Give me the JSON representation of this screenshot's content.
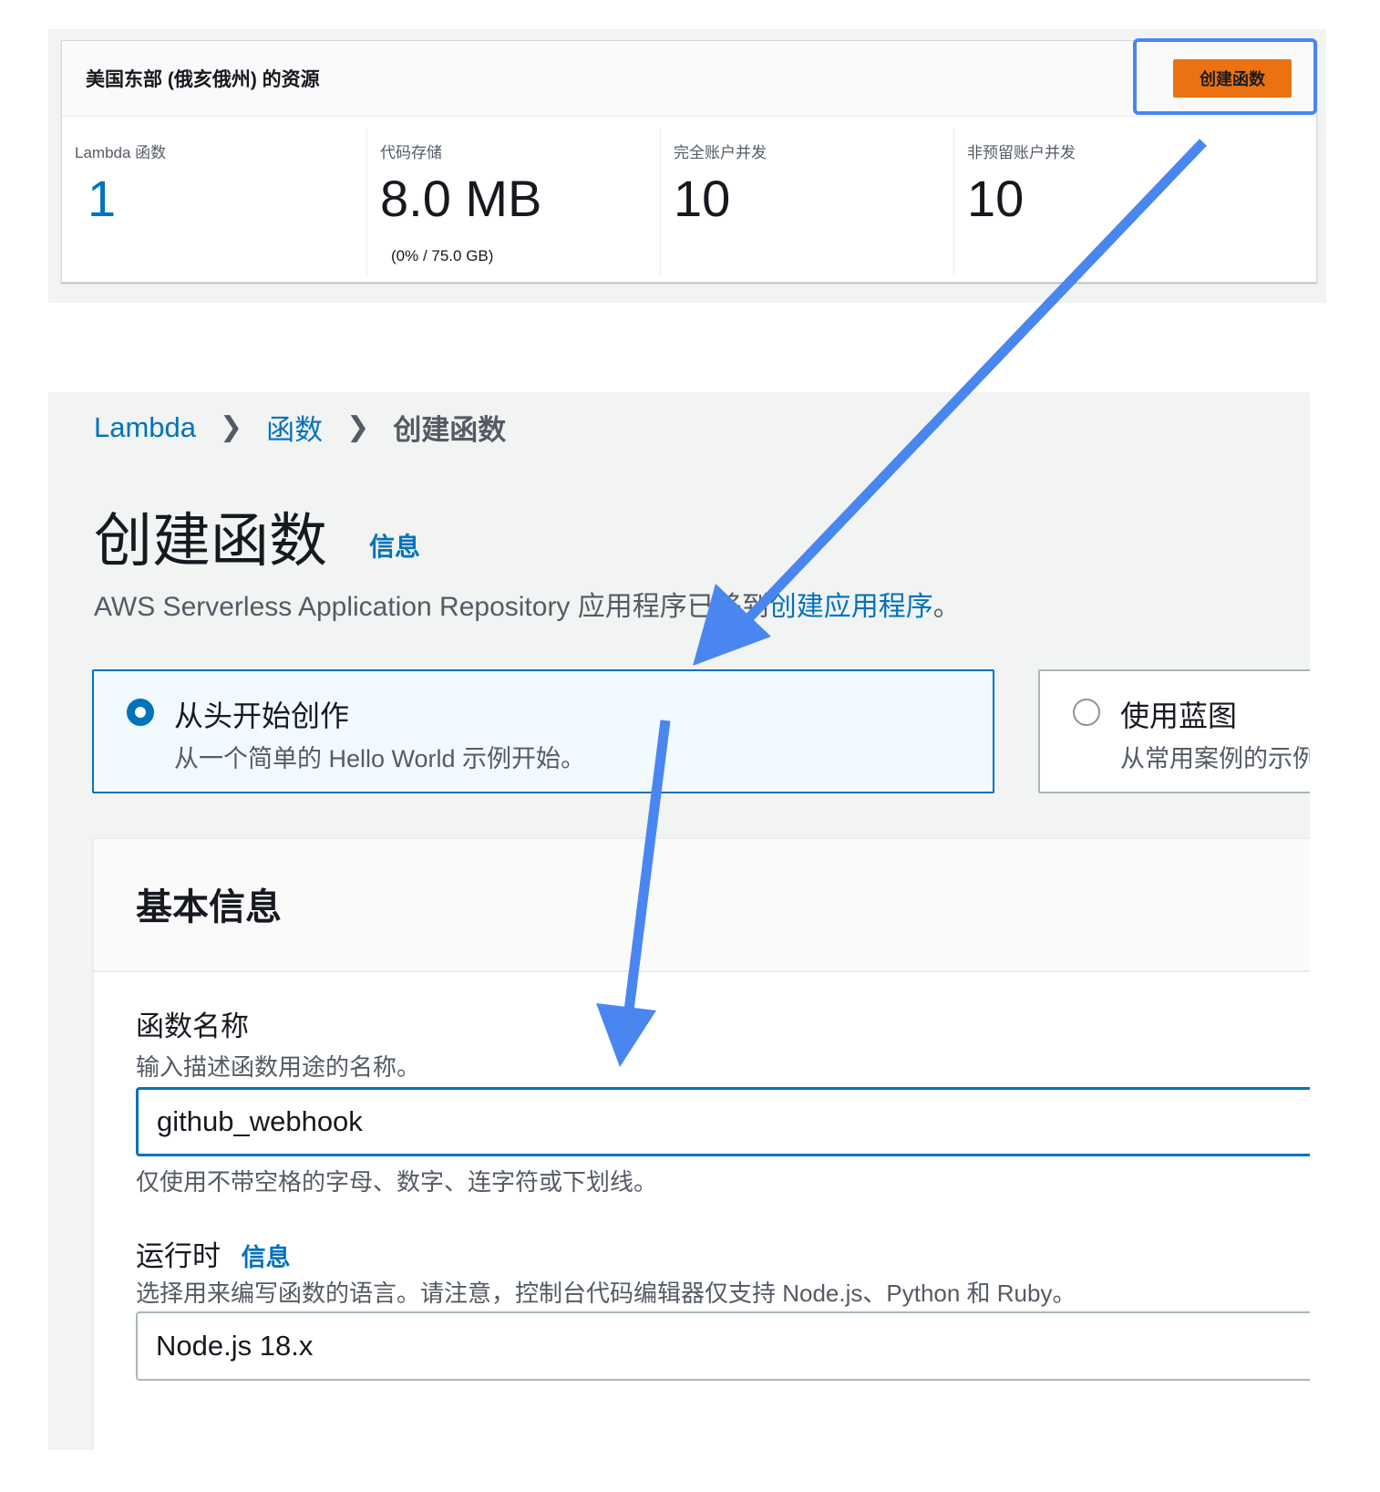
{
  "resources": {
    "title": "美国东部 (俄亥俄州) 的资源",
    "create_button": "创建函数",
    "metrics": [
      {
        "label": "Lambda 函数",
        "value": "1"
      },
      {
        "label": "代码存储",
        "value": "8.0 MB",
        "sub": "(0% / 75.0 GB)"
      },
      {
        "label": "完全账户并发",
        "value": "10"
      },
      {
        "label": "非预留账户并发",
        "value": "10"
      }
    ]
  },
  "breadcrumb": {
    "items": [
      "Lambda",
      "函数",
      "创建函数"
    ]
  },
  "page": {
    "title": "创建函数",
    "info": "信息",
    "notice_text": "AWS Serverless Application Repository 应用程序已移到",
    "notice_link": "创建应用程序",
    "notice_end": "。"
  },
  "options": [
    {
      "title": "从头开始创作",
      "desc": "从一个简单的 Hello World 示例开始。",
      "selected": true
    },
    {
      "title": "使用蓝图",
      "desc": "从常用案例的示例",
      "selected": false
    }
  ],
  "basic_info": {
    "title": "基本信息",
    "function_name": {
      "label": "函数名称",
      "desc": "输入描述函数用途的名称。",
      "value": "github_webhook",
      "hint": "仅使用不带空格的字母、数字、连字符或下划线。"
    },
    "runtime": {
      "label": "运行时",
      "info": "信息",
      "desc": "选择用来编写函数的语言。请注意，控制台代码编辑器仅支持 Node.js、Python 和 Ruby。",
      "value": "Node.js 18.x"
    }
  },
  "colors": {
    "accent": "#0073bb",
    "button": "#ec7211",
    "annotation_arrow": "#4a86f0"
  }
}
